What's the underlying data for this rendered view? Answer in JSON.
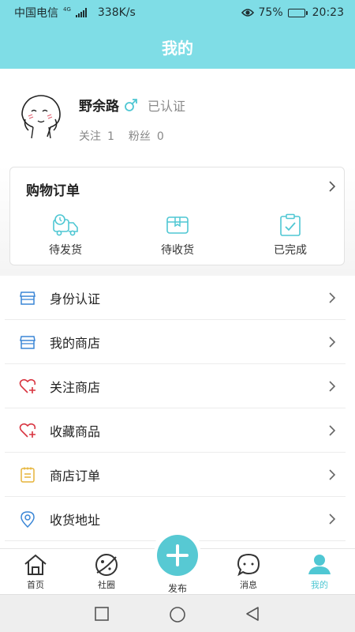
{
  "status_bar": {
    "carrier": "中国电信",
    "network": "4G",
    "speed": "338K/s",
    "battery": "75%",
    "battery_level": 0.75,
    "time": "20:23"
  },
  "header": {
    "title": "我的"
  },
  "profile": {
    "name": "野余路",
    "gender_icon": "male-symbol-icon",
    "verified": "已认证",
    "following_label": "关注",
    "following_count": "1",
    "fans_label": "粉丝",
    "fans_count": "0"
  },
  "orders": {
    "title": "购物订单",
    "items": [
      {
        "label": "待发货",
        "icon": "delivery-truck-icon"
      },
      {
        "label": "待收货",
        "icon": "package-box-icon"
      },
      {
        "label": "已完成",
        "icon": "clipboard-check-icon"
      }
    ]
  },
  "menu": {
    "items": [
      {
        "label": "身份认证",
        "icon": "store-icon"
      },
      {
        "label": "我的商店",
        "icon": "store-icon"
      },
      {
        "label": "关注商店",
        "icon": "heart-plus-icon"
      },
      {
        "label": "收藏商品",
        "icon": "heart-plus-icon"
      },
      {
        "label": "商店订单",
        "icon": "notepad-icon"
      },
      {
        "label": "收货地址",
        "icon": "location-pin-icon"
      }
    ]
  },
  "tabbar": {
    "tabs": [
      {
        "label": "首页",
        "icon": "home-icon"
      },
      {
        "label": "社圈",
        "icon": "planet-icon"
      },
      {
        "label": "发布",
        "icon": "plus-icon"
      },
      {
        "label": "消息",
        "icon": "chat-bubble-icon"
      },
      {
        "label": "我的",
        "icon": "user-icon"
      }
    ],
    "active": "我的"
  },
  "colors": {
    "header_bg": "#7fdde6",
    "accent": "#57c9d3",
    "active_tab": "#4fc7d3",
    "blue_icon": "#3a86d6",
    "red_icon": "#d8333f",
    "yellow_icon": "#e6b43a"
  }
}
